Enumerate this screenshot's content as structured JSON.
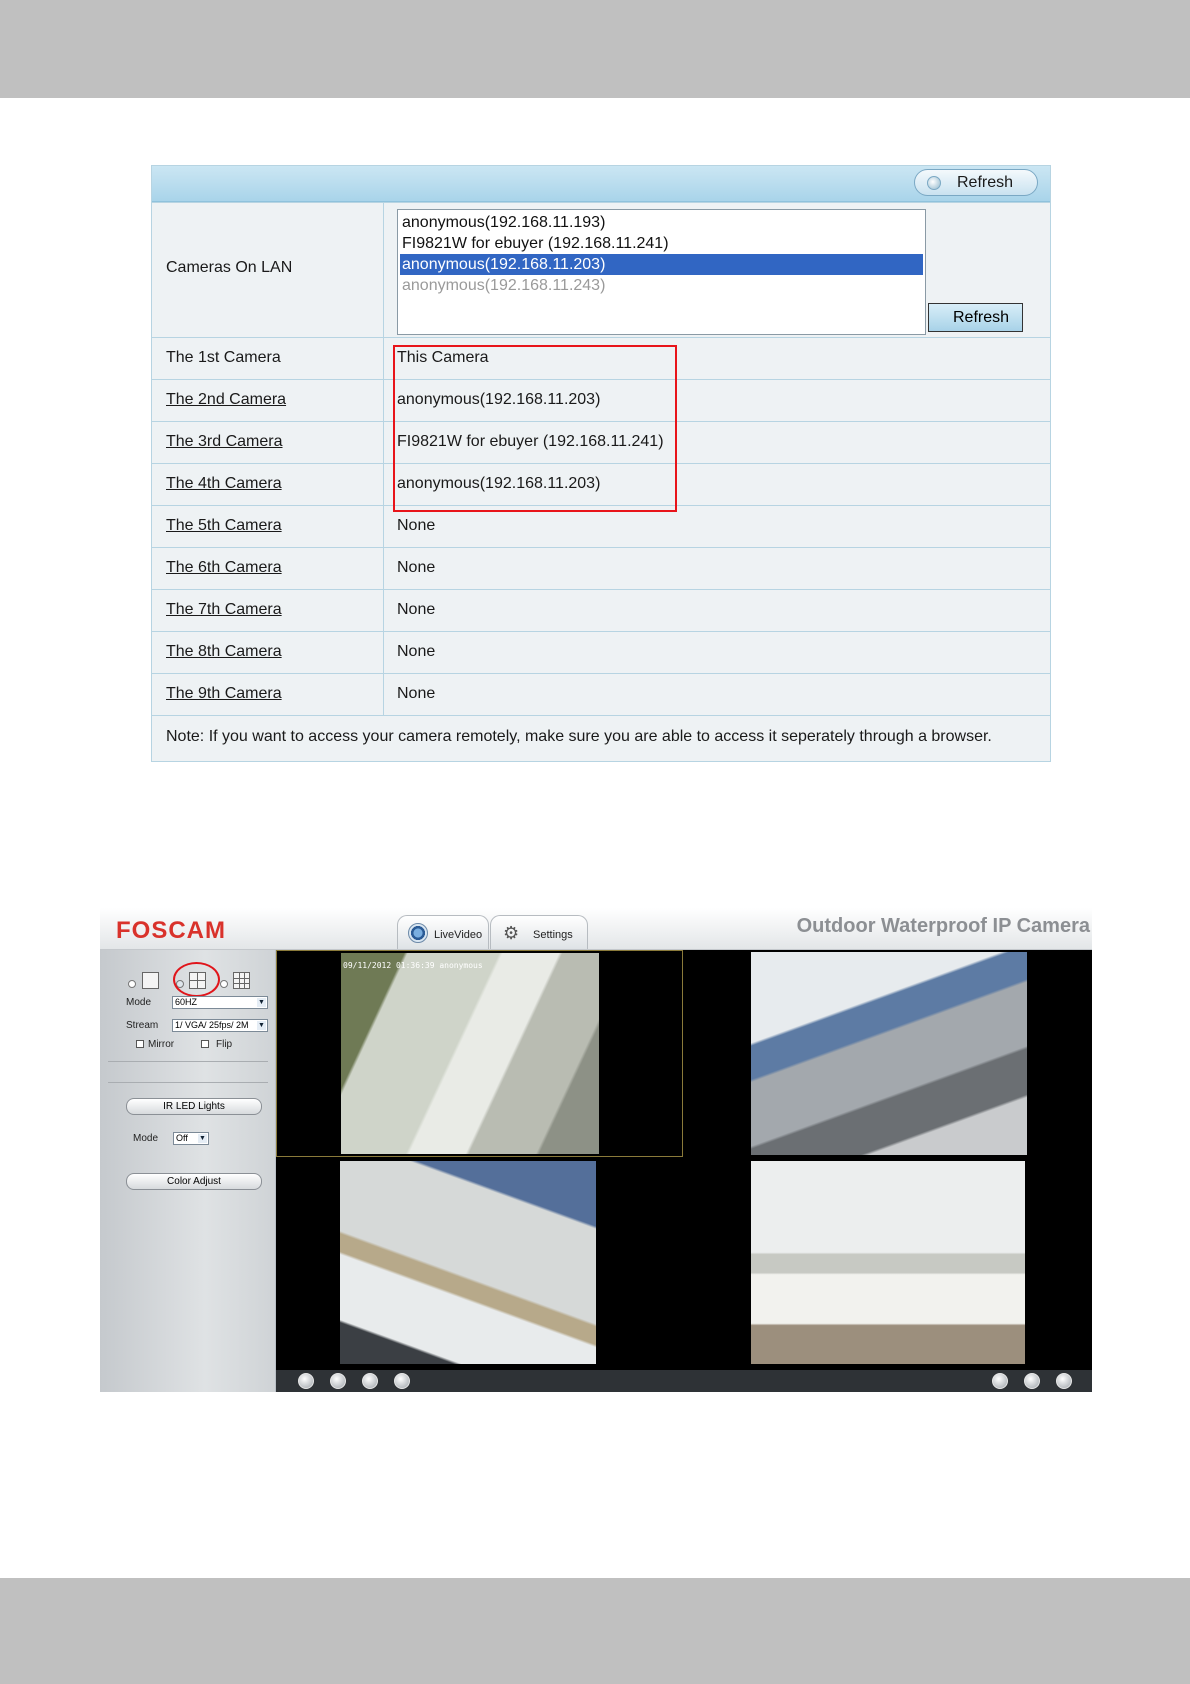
{
  "lan_panel": {
    "header_refresh_label": "Refresh",
    "cameras_on_lan_label": "Cameras On LAN",
    "lan_cameras": [
      {
        "label": "anonymous(192.168.11.193)",
        "state": "normal"
      },
      {
        "label": "FI9821W for ebuyer (192.168.11.241)",
        "state": "normal"
      },
      {
        "label": "anonymous(192.168.11.203)",
        "state": "selected"
      },
      {
        "label": "anonymous(192.168.11.243)",
        "state": "dimmed"
      }
    ],
    "list_refresh_label": "Refresh",
    "rows": [
      {
        "name": "The 1st Camera",
        "value": "This Camera"
      },
      {
        "name": "The 2nd Camera",
        "value": "anonymous(192.168.11.203)"
      },
      {
        "name": "The 3rd Camera",
        "value": "FI9821W for ebuyer (192.168.11.241)"
      },
      {
        "name": "The 4th Camera",
        "value": "anonymous(192.168.11.203)"
      },
      {
        "name": "The 5th Camera",
        "value": "None"
      },
      {
        "name": "The 6th Camera",
        "value": "None"
      },
      {
        "name": "The 7th Camera",
        "value": "None"
      },
      {
        "name": "The 8th Camera",
        "value": "None"
      },
      {
        "name": "The 9th Camera",
        "value": "None"
      }
    ],
    "note": "Note: If you want to access your camera remotely, make sure you are able to access it seperately through a browser."
  },
  "live_view": {
    "logo": "FOSCAM",
    "tabs": {
      "live_video": "LiveVideo",
      "settings": "Settings"
    },
    "product_title": "Outdoor Waterproof IP Camera",
    "sidebar": {
      "mode_label": "Mode",
      "mode_value": "60HZ",
      "stream_label": "Stream",
      "stream_value": "1/ VGA/ 25fps/ 2M",
      "mirror_label": "Mirror",
      "flip_label": "Flip",
      "ir_led_label": "IR LED Lights",
      "ir_mode_label": "Mode",
      "ir_mode_value": "Off",
      "color_adjust_label": "Color Adjust"
    },
    "video_timestamp": "09/11/2012 01:36:39 anonymous"
  },
  "colors": {
    "link": "#1b23c9",
    "highlight_red": "#e8141a",
    "selected_row": "#3166c3",
    "panel_header": "#a9d4ea"
  }
}
